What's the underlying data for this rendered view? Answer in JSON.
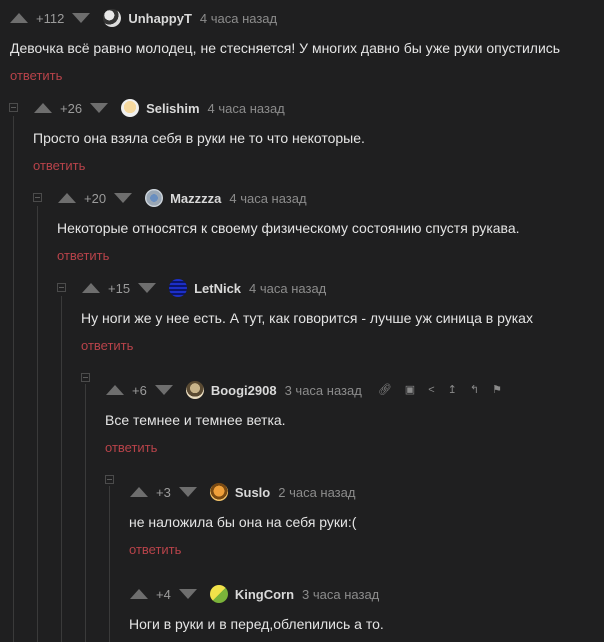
{
  "comments": [
    {
      "rating": "+112",
      "author": "UnhappyT",
      "time": "4 часа назад",
      "text": "Девочка всё равно молодец, не стесняется! У многих давно бы уже руки опустились",
      "reply": "ответить"
    },
    {
      "rating": "+26",
      "author": "Selishim",
      "time": "4 часа назад",
      "text": "Просто она взяла себя в руки не то что некоторые.",
      "reply": "ответить"
    },
    {
      "rating": "+20",
      "author": "Mazzzza",
      "time": "4 часа назад",
      "text": "Некоторые относятся к своему физическому состоянию спустя рукава.",
      "reply": "ответить"
    },
    {
      "rating": "+15",
      "author": "LetNick",
      "time": "4 часа назад",
      "text": "Ну ноги же у нее есть. А тут, как говорится - лучше уж синица в руках",
      "reply": "ответить"
    },
    {
      "rating": "+6",
      "author": "Boogi2908",
      "time": "3 часа назад",
      "text": "Все темнее и темнее ветка.",
      "reply": "ответить"
    },
    {
      "rating": "+3",
      "author": "Suslo",
      "time": "2 часа назад",
      "text": "не наложила бы она на себя руки:(",
      "reply": "ответить"
    },
    {
      "rating": "+4",
      "author": "KingCorn",
      "time": "3 часа назад",
      "text": "Ноги в руки и в перед,облenились а то.",
      "reply": ""
    }
  ],
  "colors": {
    "background": "#1f1f20",
    "reply_link": "#b8434a",
    "vote_arrow": "#6e6e6e"
  },
  "icons": [
    "link-icon",
    "save-icon",
    "share-icon",
    "scroll-to-parent-icon",
    "scroll-to-root-icon",
    "report-flag-icon"
  ]
}
